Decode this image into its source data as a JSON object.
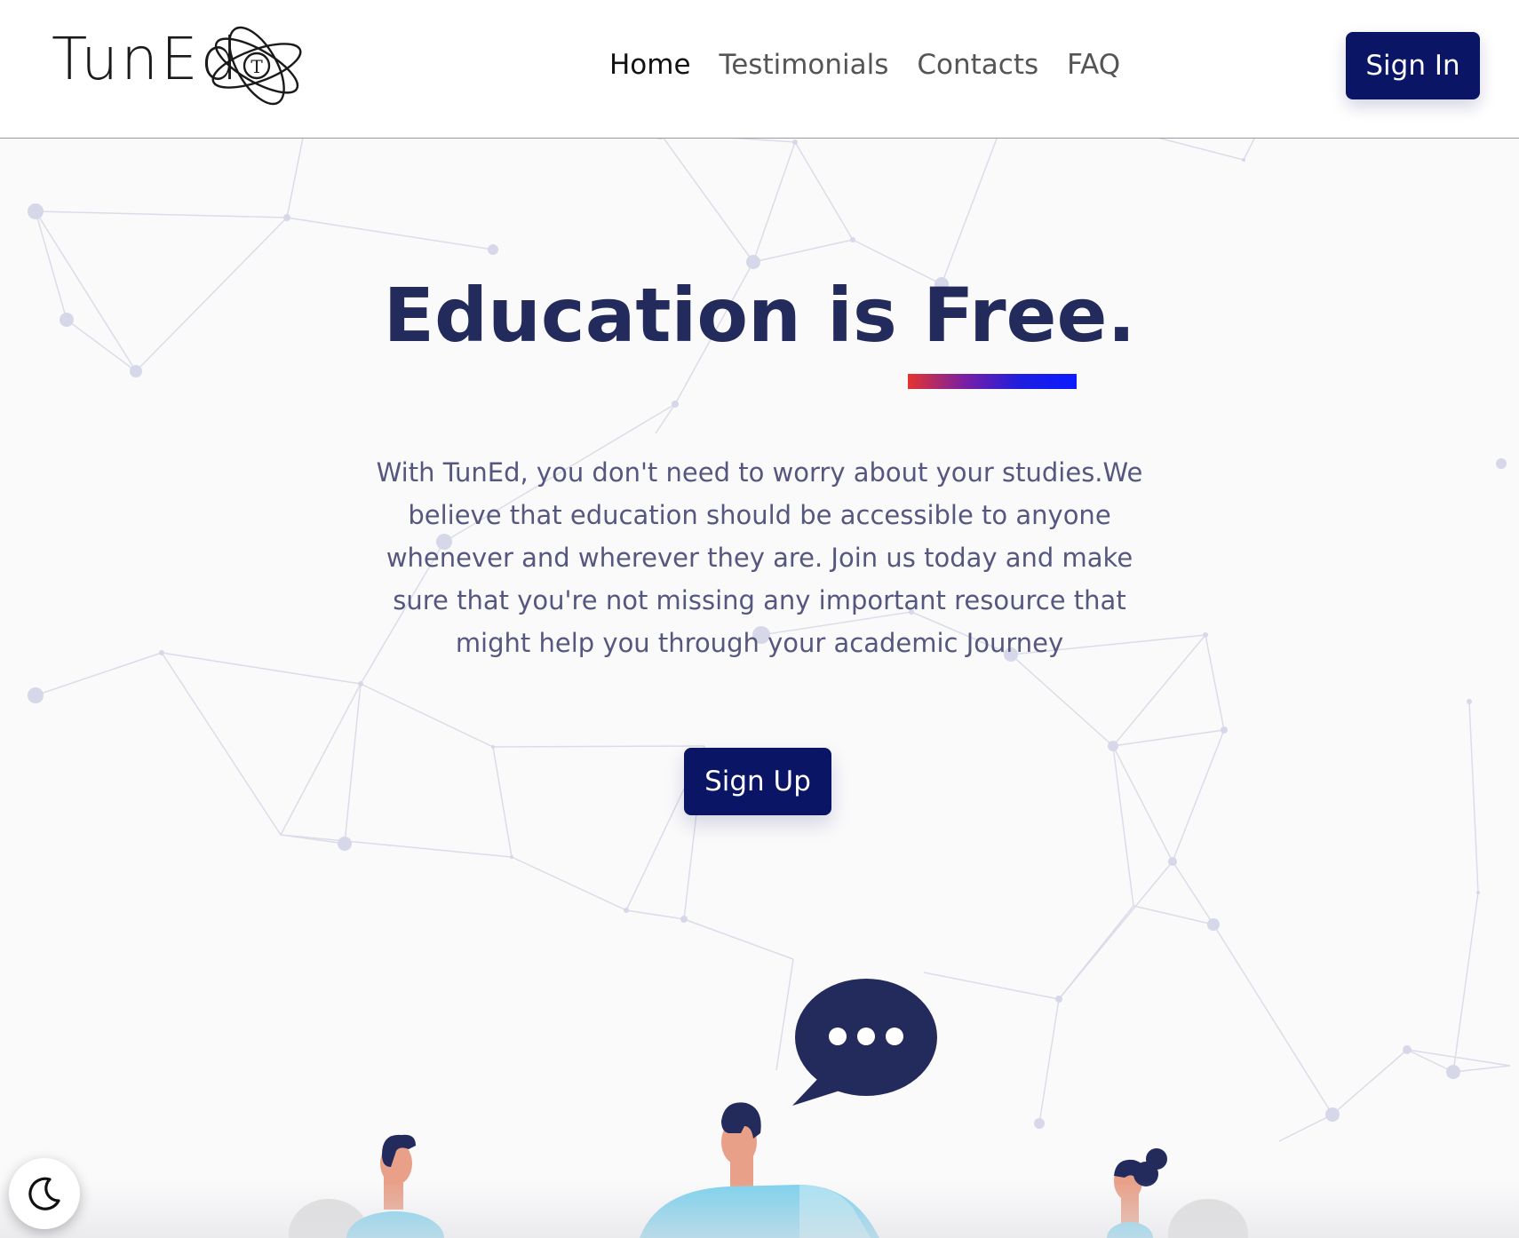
{
  "brand": {
    "logo_text": "TunEd",
    "logo_icon": "atom-icon",
    "logo_letter": "T"
  },
  "nav": {
    "items": [
      {
        "label": "Home",
        "active": true
      },
      {
        "label": "Testimonials",
        "active": false
      },
      {
        "label": "Contacts",
        "active": false
      },
      {
        "label": "FAQ",
        "active": false
      }
    ],
    "signin_label": "Sign In"
  },
  "hero": {
    "title": "Education is Free.",
    "description": "With TunEd, you don't need to worry about your studies.We believe that education should be accessible to anyone whenever and wherever they are. Join us today and make sure that you're not missing any important resource that might help you through your academic Journey",
    "signup_label": "Sign Up"
  },
  "illustration": {
    "icon": "people-chatting-illustration",
    "bubble_icon": "speech-bubble-icon"
  },
  "theme_toggle": {
    "icon": "moon-icon"
  },
  "colors": {
    "primary": "#0b1566",
    "title": "#232a5c",
    "text": "#55577e",
    "gradient_start": "#e3342f",
    "gradient_end": "#0b1cff",
    "bubble": "#232a5c",
    "person_shirt": "#7ed1ec",
    "skin": "#e8a088"
  }
}
